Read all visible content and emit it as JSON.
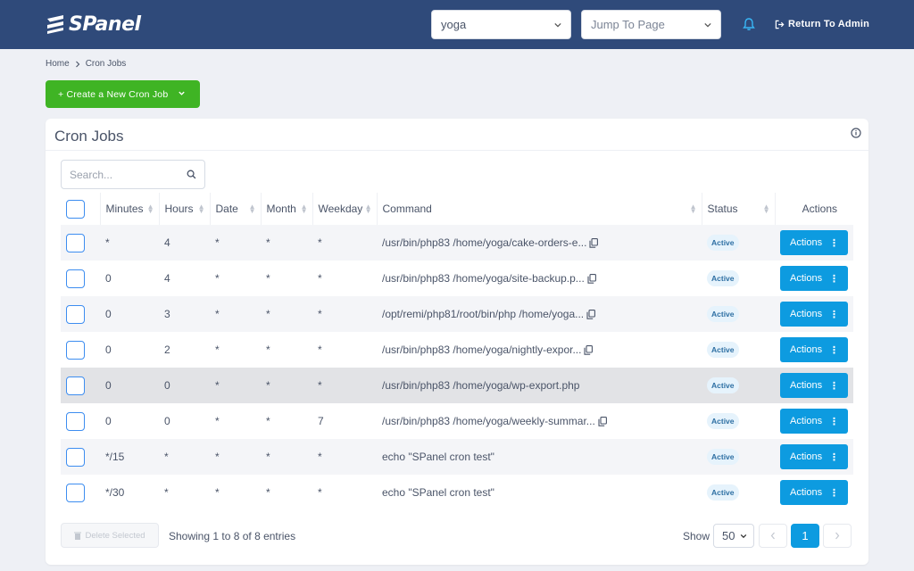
{
  "header": {
    "logo_text": "SPanel",
    "account_select": "yoga",
    "jump_placeholder": "Jump To Page",
    "return_label": "Return To Admin"
  },
  "breadcrumb": {
    "home": "Home",
    "current": "Cron Jobs"
  },
  "create_button": "+ Create a New Cron Job",
  "card": {
    "title": "Cron Jobs",
    "search_placeholder": "Search..."
  },
  "table": {
    "columns": [
      "Minutes",
      "Hours",
      "Date",
      "Month",
      "Weekday",
      "Command",
      "Status",
      "Actions"
    ],
    "rows": [
      {
        "minutes": "*",
        "hours": "4",
        "date": "*",
        "month": "*",
        "weekday": "*",
        "command": "/usr/bin/php83 /home/yoga/cake-orders-e...",
        "copy": true,
        "status": "Active",
        "action": "Actions"
      },
      {
        "minutes": "0",
        "hours": "4",
        "date": "*",
        "month": "*",
        "weekday": "*",
        "command": "/usr/bin/php83 /home/yoga/site-backup.p...",
        "copy": true,
        "status": "Active",
        "action": "Actions"
      },
      {
        "minutes": "0",
        "hours": "3",
        "date": "*",
        "month": "*",
        "weekday": "*",
        "command": "/opt/remi/php81/root/bin/php /home/yoga...",
        "copy": true,
        "status": "Active",
        "action": "Actions"
      },
      {
        "minutes": "0",
        "hours": "2",
        "date": "*",
        "month": "*",
        "weekday": "*",
        "command": "/usr/bin/php83 /home/yoga/nightly-expor...",
        "copy": true,
        "status": "Active",
        "action": "Actions"
      },
      {
        "minutes": "0",
        "hours": "0",
        "date": "*",
        "month": "*",
        "weekday": "*",
        "command": "/usr/bin/php83 /home/yoga/wp-export.php",
        "copy": false,
        "status": "Active",
        "action": "Actions"
      },
      {
        "minutes": "0",
        "hours": "0",
        "date": "*",
        "month": "*",
        "weekday": "7",
        "command": "/usr/bin/php83 /home/yoga/weekly-summar...",
        "copy": true,
        "status": "Active",
        "action": "Actions"
      },
      {
        "minutes": "*/15",
        "hours": "*",
        "date": "*",
        "month": "*",
        "weekday": "*",
        "command": "echo \"SPanel cron test\"",
        "copy": false,
        "status": "Active",
        "action": "Actions"
      },
      {
        "minutes": "*/30",
        "hours": "*",
        "date": "*",
        "month": "*",
        "weekday": "*",
        "command": "echo \"SPanel cron test\"",
        "copy": false,
        "status": "Active",
        "action": "Actions"
      }
    ]
  },
  "footer": {
    "delete_label": "Delete Selected",
    "showing": "Showing 1 to 8 of 8 entries",
    "show_label": "Show",
    "page_size": "50",
    "current_page": "1"
  },
  "colors": {
    "topbar": "#2f4a7a",
    "create": "#3fb424",
    "primary": "#0d9be0"
  }
}
